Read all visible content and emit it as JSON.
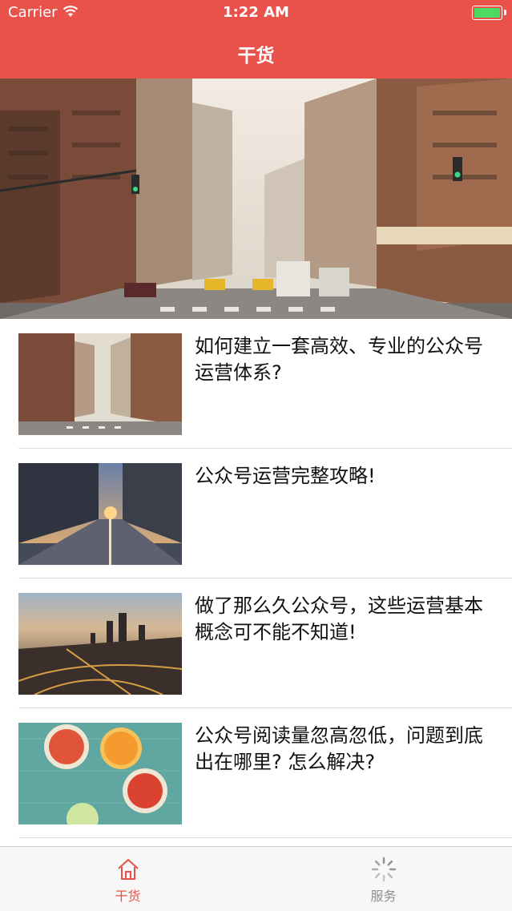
{
  "status_bar": {
    "carrier": "Carrier",
    "time": "1:22 AM"
  },
  "nav": {
    "title": "干货"
  },
  "articles": [
    {
      "title": "如何建立一套高效、专业的公众号运营体系?"
    },
    {
      "title": "公众号运营完整攻略!"
    },
    {
      "title": "做了那么久公众号，这些运营基本概念可不能不知道!"
    },
    {
      "title": "公众号阅读量忽高忽低，问题到底出在哪里? 怎么解决?"
    }
  ],
  "tabbar": {
    "items": [
      {
        "label": "干货",
        "icon": "home-icon",
        "active": true
      },
      {
        "label": "服务",
        "icon": "spinner-icon",
        "active": false
      }
    ]
  },
  "colors": {
    "accent": "#e8524a",
    "battery": "#4cd964"
  }
}
